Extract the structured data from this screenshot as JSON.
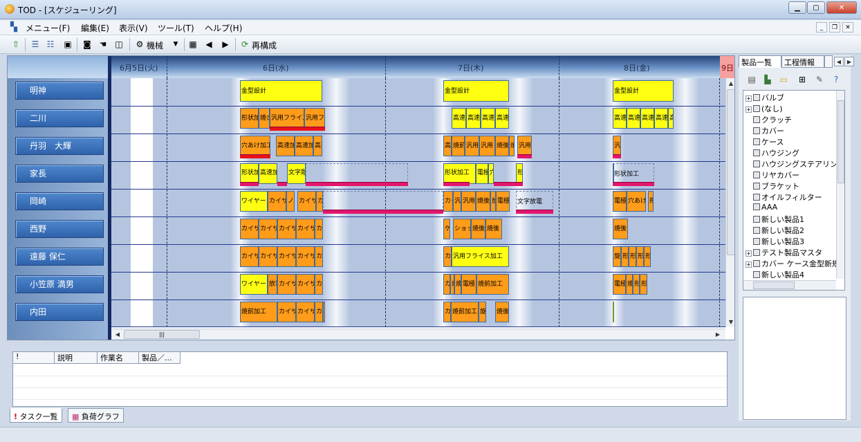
{
  "window": {
    "title": "TOD - [スケジューリング]"
  },
  "menu": [
    "メニュー(F)",
    "編集(E)",
    "表示(V)",
    "ツール(T)",
    "ヘルプ(H)"
  ],
  "toolbar": {
    "machine_label": "機械",
    "rebuild_label": "再構成"
  },
  "dates": [
    "6月5日(火)",
    "6日(水)",
    "7日(木)",
    "8日(金)",
    "9日"
  ],
  "resources": [
    "明神",
    "二川",
    "丹羽　大輝",
    "家長",
    "岡崎",
    "西野",
    "遠藤 保仁",
    "小笠原 満男",
    "内田"
  ],
  "tasks": {
    "r0": [
      "金型設計",
      "金型設計",
      "金型設計"
    ],
    "r1": [
      "形状加工",
      "焼き",
      "汎用フライス加",
      "汎用フライス",
      "高速",
      "高速",
      "高速",
      "高速",
      "高速",
      "高速",
      "高速",
      "高速",
      "高速",
      "高速"
    ],
    "r2": [
      "穴あけ加工",
      "高速加",
      "高速加",
      "高速",
      "高速",
      "焼前",
      "汎用",
      "汎用",
      "焼後",
      "焼",
      "汎用",
      "汎"
    ],
    "r3": [
      "形状加工",
      "高速加工",
      "文字彫",
      "形状加工",
      "電極",
      "穴",
      "形",
      "形状加工"
    ],
    "r4": [
      "ワイヤーカット",
      "カイサ",
      "ノ",
      "カイサ",
      "カイ",
      "カイ",
      "汎用",
      "汎用",
      "焼後",
      "放",
      "電極",
      "文字放電",
      "電極",
      "穴あけ",
      "形"
    ],
    "r5": [
      "カイサ",
      "カイサ",
      "カイサ",
      "カイサ",
      "カイ",
      "ケ",
      "ショット",
      "焼後",
      "焼後",
      "焼後"
    ],
    "r6": [
      "カイサ",
      "カイサ",
      "カイサ",
      "カイサ",
      "カイ",
      "カ",
      "汎用フライス加工",
      "旋盤",
      "形",
      "形",
      "形",
      "形"
    ],
    "r7": [
      "ワイヤーカット",
      "放電",
      "カイサ",
      "カイサ",
      "カイ",
      "カ",
      "焼",
      "焼",
      "電極",
      "焼前加工",
      "電極",
      "焼",
      "形",
      "形"
    ],
    "r8": [
      "焼前加工",
      "カイサ",
      "カイサ",
      "カイ",
      "カイ",
      "カ",
      "焼前加工",
      "旋",
      "焼後"
    ]
  },
  "right_tabs": [
    "製品一覧",
    "工程情報"
  ],
  "tree": [
    "バルブ",
    "(なし)",
    "クラッチ",
    "カバー",
    "ケース",
    "ハウジング",
    "ハウジングステアリン",
    "リヤカバー",
    "ブラケット",
    "オイルフィルター",
    "AAA",
    "新しい製品1",
    "新しい製品2",
    "新しい製品3",
    "テスト製品マスタ",
    "カバー ケース金型新規",
    "新しい製品4"
  ],
  "task_columns": [
    "!",
    "説明",
    "作業名",
    "製品／..."
  ],
  "bottom_tabs": [
    "タスク一覧",
    "負荷グラフ"
  ],
  "colors": {
    "task_yellow": "#ffff12",
    "task_orange": "#ff9c1a",
    "bar_pink": "#e3166c",
    "resource_button": "#3a70b8"
  }
}
